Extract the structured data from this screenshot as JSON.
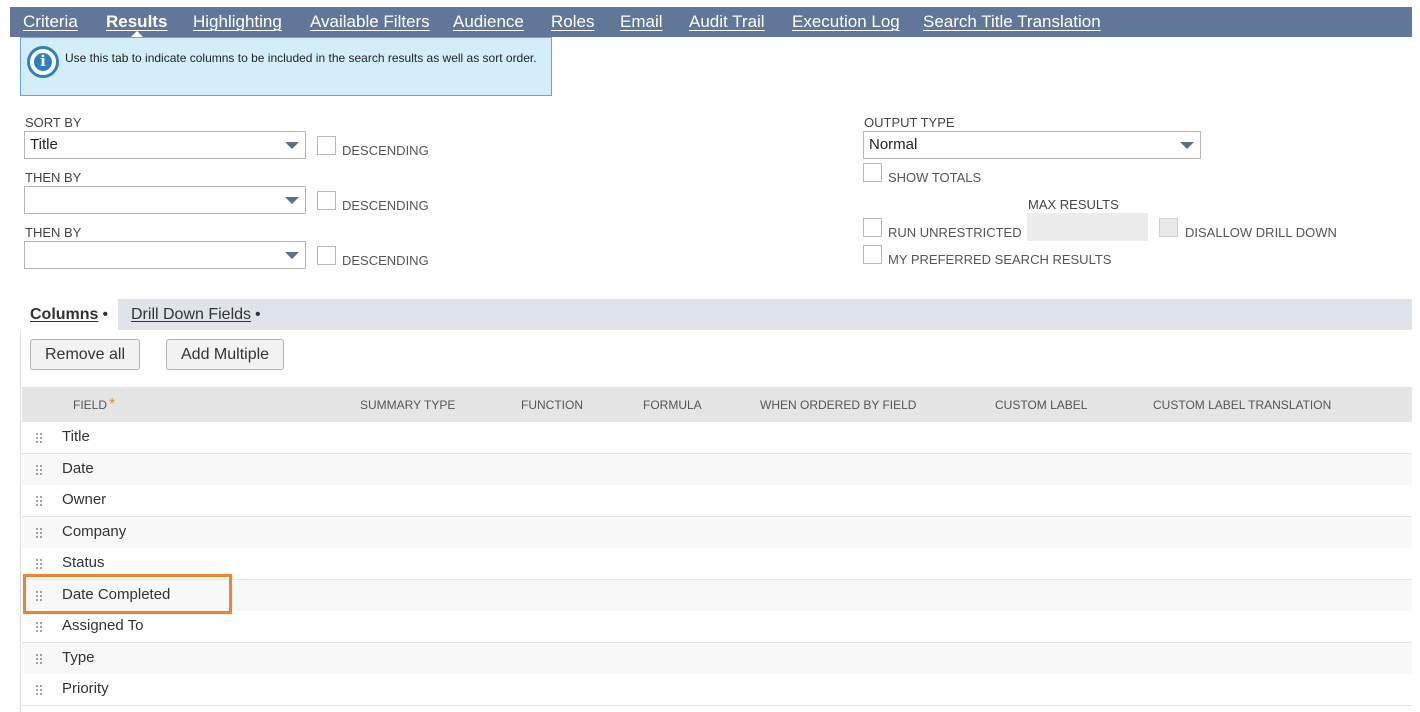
{
  "tabs": [
    {
      "label": "Criteria",
      "active": false
    },
    {
      "label": "Results",
      "active": true
    },
    {
      "label": "Highlighting",
      "active": false
    },
    {
      "label": "Available Filters",
      "active": false
    },
    {
      "label": "Audience",
      "active": false
    },
    {
      "label": "Roles",
      "active": false
    },
    {
      "label": "Email",
      "active": false
    },
    {
      "label": "Audit Trail",
      "active": false
    },
    {
      "label": "Execution Log",
      "active": false
    },
    {
      "label": "Search Title Translation",
      "active": false
    }
  ],
  "info": {
    "text": "Use this tab to indicate columns to be included in the search results as well as sort order.",
    "icon": "info-icon"
  },
  "sort": {
    "sort_by_label": "SORT BY",
    "sort_by_value": "Title",
    "then_by_1_label": "THEN BY",
    "then_by_1_value": "",
    "then_by_2_label": "THEN BY",
    "then_by_2_value": "",
    "descending_label": "DESCENDING"
  },
  "output": {
    "output_type_label": "OUTPUT TYPE",
    "output_type_value": "Normal",
    "show_totals_label": "SHOW TOTALS",
    "max_results_label": "MAX RESULTS",
    "run_unrestricted_label": "RUN UNRESTRICTED",
    "disallow_drill_down_label": "DISALLOW DRILL DOWN",
    "my_preferred_label": "MY PREFERRED SEARCH RESULTS"
  },
  "subtabs": [
    {
      "label": "Columns",
      "dot": "•",
      "active": true
    },
    {
      "label": "Drill Down Fields",
      "dot": "•",
      "active": false
    }
  ],
  "buttons": {
    "remove_all": "Remove all",
    "add_multiple": "Add Multiple"
  },
  "table": {
    "headers": {
      "field": "FIELD",
      "required_mark": "*",
      "summary_type": "SUMMARY TYPE",
      "function": "FUNCTION",
      "formula": "FORMULA",
      "when_ordered_by_field": "WHEN ORDERED BY FIELD",
      "custom_label": "CUSTOM LABEL",
      "custom_label_translation": "CUSTOM LABEL TRANSLATION"
    },
    "rows": [
      "Title",
      "Date",
      "Owner",
      "Company",
      "Status",
      "Date Completed",
      "Assigned To",
      "Type",
      "Priority"
    ],
    "highlighted_row": "Date Completed"
  },
  "colors": {
    "tabbar": "#607799",
    "info_bg": "#d4eef9",
    "highlight": "#f5832a"
  }
}
